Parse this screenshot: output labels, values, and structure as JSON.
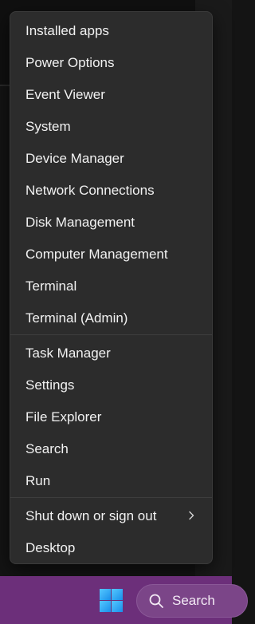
{
  "menu": {
    "items": [
      {
        "label": "Installed apps"
      },
      {
        "label": "Power Options"
      },
      {
        "label": "Event Viewer"
      },
      {
        "label": "System"
      },
      {
        "label": "Device Manager"
      },
      {
        "label": "Network Connections"
      },
      {
        "label": "Disk Management"
      },
      {
        "label": "Computer Management"
      },
      {
        "label": "Terminal"
      },
      {
        "label": "Terminal (Admin)"
      },
      {
        "label": "Task Manager"
      },
      {
        "label": "Settings"
      },
      {
        "label": "File Explorer"
      },
      {
        "label": "Search"
      },
      {
        "label": "Run"
      },
      {
        "label": "Shut down or sign out",
        "icon": "chevron-right-icon"
      },
      {
        "label": "Desktop"
      }
    ]
  },
  "taskbar": {
    "start_icon": "windows-logo-icon",
    "search": {
      "label": "Search",
      "icon": "search-icon"
    }
  },
  "colors": {
    "menu_background": "#2c2c2c",
    "menu_text": "#f2f2f2",
    "taskbar": "#6c2f7a",
    "windows_logo": "#1a8fea"
  }
}
